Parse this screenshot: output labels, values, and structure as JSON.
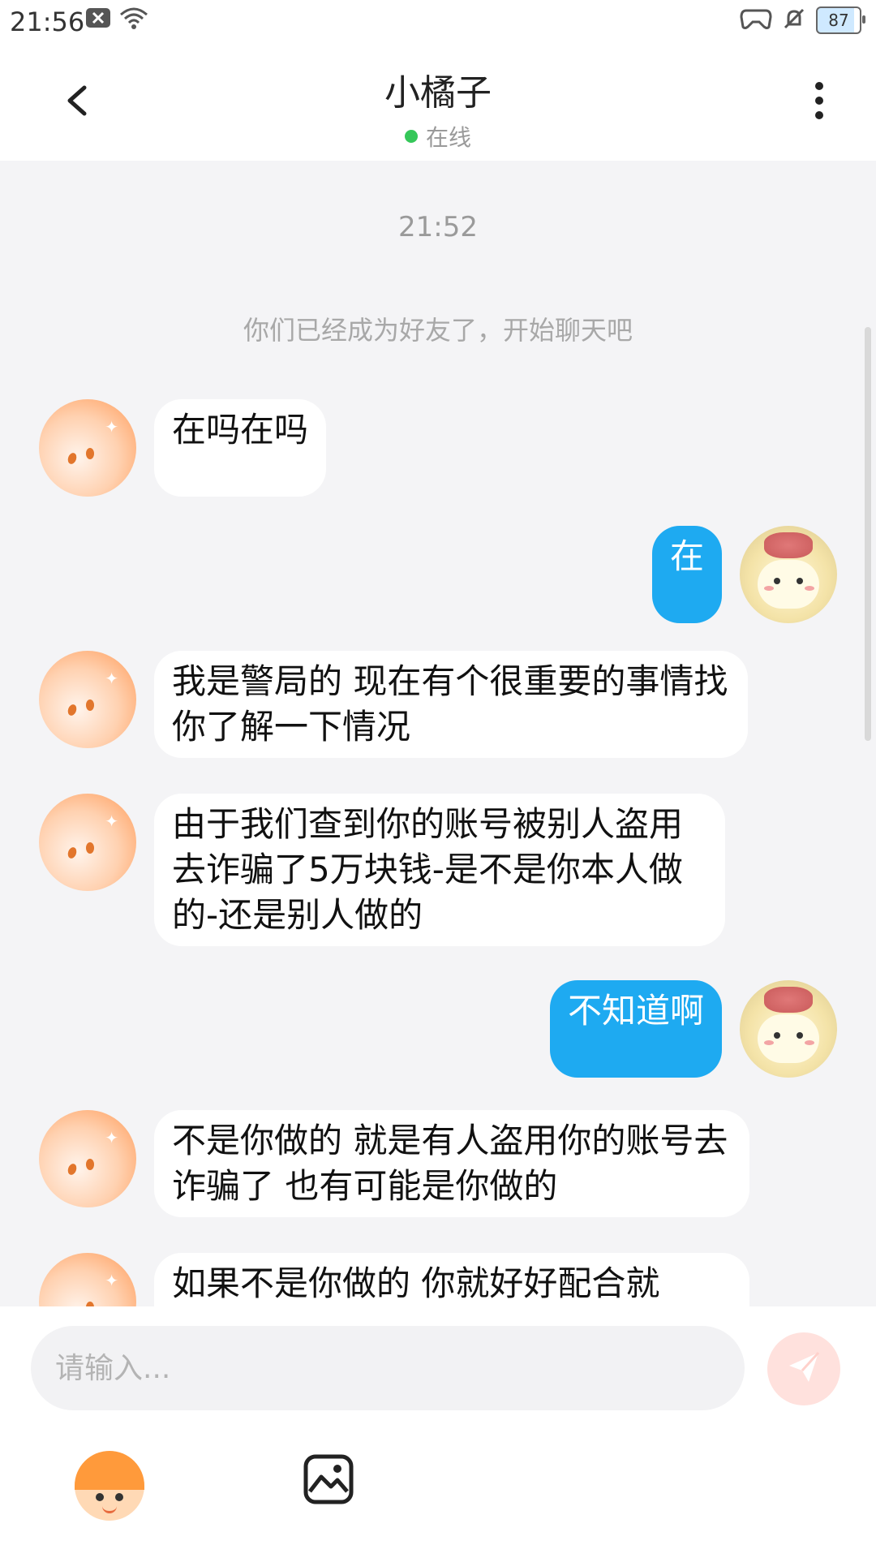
{
  "status_bar": {
    "time": "21:56",
    "battery": "87",
    "icons": [
      "notification-x-icon",
      "wifi-icon",
      "game-controller-icon",
      "bell-muted-icon",
      "battery-icon"
    ]
  },
  "header": {
    "title": "小橘子",
    "presence": "在线",
    "icons": [
      "back-arrow-icon",
      "more-vertical-icon"
    ]
  },
  "chat": {
    "timestamp": "21:52",
    "system_note": "你们已经成为好友了，开始聊天吧",
    "messages": [
      {
        "side": "left",
        "text": "在吗在吗"
      },
      {
        "side": "right",
        "text": "在"
      },
      {
        "side": "left",
        "text": "我是警局的 现在有个很重要的事情找你了解一下情况"
      },
      {
        "side": "left",
        "text": "由于我们查到你的账号被别人盗用去诈骗了5万块钱-是不是你本人做的-还是别人做的"
      },
      {
        "side": "right",
        "text": "不知道啊"
      },
      {
        "side": "left",
        "text": "不是你做的 就是有人盗用你的账号去诈骗了 也有可能是你做的"
      },
      {
        "side": "left",
        "text": "如果不是你做的 你就好好配合就"
      }
    ]
  },
  "composer": {
    "placeholder": "请输入...",
    "icons": [
      "send-icon",
      "emoji-avatar-icon",
      "image-icon"
    ]
  },
  "colors": {
    "outgoing_bubble": "#1eaaf1",
    "online_dot": "#35c759",
    "send_button": "#ffe1dd"
  }
}
